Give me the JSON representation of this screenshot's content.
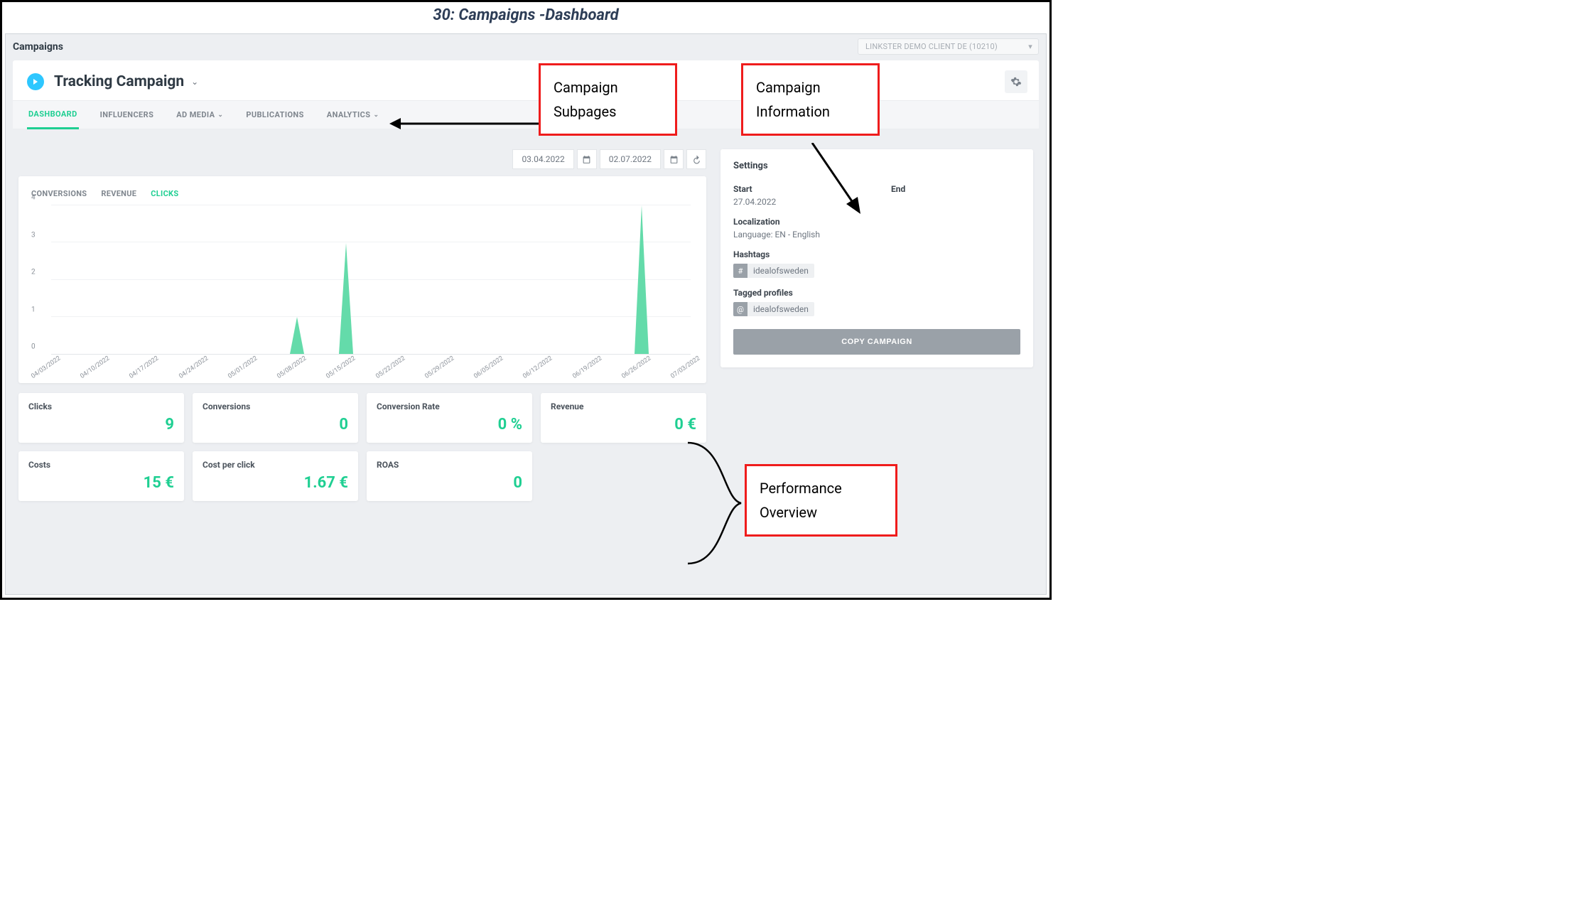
{
  "slide": {
    "title": "30: Campaigns -Dashboard"
  },
  "topbar": {
    "title": "Campaigns",
    "client": "LINKSTER DEMO CLIENT DE (10210)"
  },
  "campaign": {
    "name": "Tracking Campaign"
  },
  "tabs": [
    {
      "label": "DASHBOARD",
      "active": true,
      "chevron": false
    },
    {
      "label": "INFLUENCERS",
      "active": false,
      "chevron": false
    },
    {
      "label": "AD MEDIA",
      "active": false,
      "chevron": true
    },
    {
      "label": "PUBLICATIONS",
      "active": false,
      "chevron": false
    },
    {
      "label": "ANALYTICS",
      "active": false,
      "chevron": true
    }
  ],
  "daterange": {
    "start": "03.04.2022",
    "end": "02.07.2022"
  },
  "chart_tabs": [
    {
      "label": "CONVERSIONS",
      "active": false
    },
    {
      "label": "REVENUE",
      "active": false
    },
    {
      "label": "CLICKS",
      "active": true
    }
  ],
  "chart_data": {
    "type": "line",
    "title": "",
    "xlabel": "",
    "ylabel": "",
    "ylim": [
      0,
      4
    ],
    "y_ticks": [
      0,
      1,
      2,
      3,
      4
    ],
    "categories": [
      "04/03/2022",
      "04/10/2022",
      "04/17/2022",
      "04/24/2022",
      "05/01/2022",
      "05/08/2022",
      "05/15/2022",
      "05/22/2022",
      "05/29/2022",
      "06/05/2022",
      "06/12/2022",
      "06/19/2022",
      "06/26/2022",
      "07/03/2022"
    ],
    "values": [
      0,
      0,
      0,
      0,
      0,
      1,
      3,
      0,
      0,
      0,
      0,
      0,
      4,
      0
    ]
  },
  "kpis": [
    {
      "label": "Clicks",
      "value": "9"
    },
    {
      "label": "Conversions",
      "value": "0"
    },
    {
      "label": "Conversion Rate",
      "value": "0 %"
    },
    {
      "label": "Revenue",
      "value": "0 €"
    },
    {
      "label": "Costs",
      "value": "15 €"
    },
    {
      "label": "Cost per click",
      "value": "1.67 €"
    },
    {
      "label": "ROAS",
      "value": "0"
    }
  ],
  "settings": {
    "title": "Settings",
    "start_label": "Start",
    "start_value": "27.04.2022",
    "end_label": "End",
    "end_value": "",
    "localization_label": "Localization",
    "localization_value": "Language: EN - English",
    "hashtags_label": "Hashtags",
    "hashtag": "idealofsweden",
    "tagged_label": "Tagged profiles",
    "tagged_profile": "idealofsweden",
    "copy_button": "COPY CAMPAIGN"
  },
  "annotations": {
    "subpages": "Campaign\nSubpages",
    "information": "Campaign\nInformation",
    "performance": "Performance\nOverview"
  }
}
